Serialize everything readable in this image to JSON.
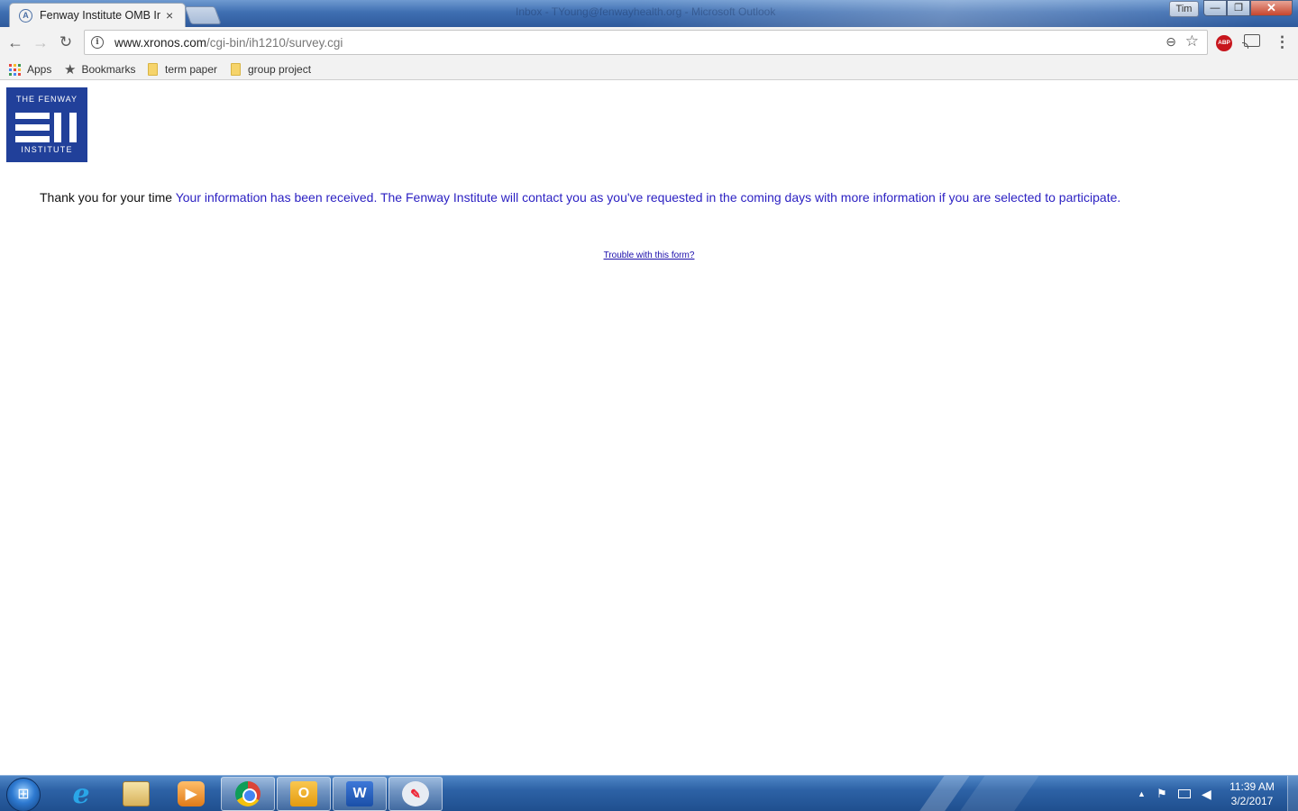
{
  "window": {
    "title": "Inbox - TYoung@fenwayhealth.org - Microsoft Outlook",
    "user": "Tim",
    "minimize_glyph": "—",
    "maximize_glyph": "❐",
    "close_glyph": "✕"
  },
  "tab": {
    "title": "Fenway Institute OMB Int",
    "favicon_letter": "A",
    "close_glyph": "×"
  },
  "toolbar": {
    "url_host": "www.xronos.com",
    "url_path": "/cgi-bin/ih1210/survey.cgi",
    "back_glyph": "←",
    "forward_glyph": "→",
    "reload_glyph": "↻",
    "info_glyph": "i",
    "zoom_glyph": "⊖",
    "star_glyph": "☆",
    "abp_label": "ABP",
    "menu_glyph": "⋮"
  },
  "bookmarks": {
    "apps_label": "Apps",
    "bookmarks_label": "Bookmarks",
    "folders": [
      "term paper",
      "group project"
    ],
    "apps_colors": [
      "#e8453c",
      "#f9bb2d",
      "#3b9a54",
      "#4a89f3",
      "#e8453c",
      "#f9bb2d",
      "#3b9a54",
      "#4a89f3",
      "#e8453c"
    ]
  },
  "page": {
    "logo_top": "THE FENWAY",
    "logo_bottom": "INSTITUTE",
    "thanks_text": "Thank you for your time",
    "info_text": "Your information has been received. The Fenway Institute will contact you as you've requested in the coming days with more information if you are selected to participate.",
    "trouble_link": "Trouble with this form?"
  },
  "taskbar": {
    "start_glyph": "⊞",
    "items": [
      "internet-explorer",
      "windows-explorer",
      "media-player",
      "chrome",
      "outlook",
      "word",
      "paint"
    ],
    "active_items": [
      "chrome",
      "outlook",
      "word",
      "paint"
    ],
    "ie_glyph": "e",
    "outlook_glyph": "O",
    "word_glyph": "W",
    "paint_glyph": "✎",
    "media_glyph": "▶",
    "tray_arrow": "▲",
    "tray_flag": "⚑",
    "tray_volume": "◀",
    "time": "11:39 AM",
    "date": "3/2/2017"
  },
  "colors": {
    "logo_blue": "#21409a",
    "message_blue": "#2a1fc2",
    "link_blue": "#1a0dab",
    "abp_red": "#c7161d"
  }
}
